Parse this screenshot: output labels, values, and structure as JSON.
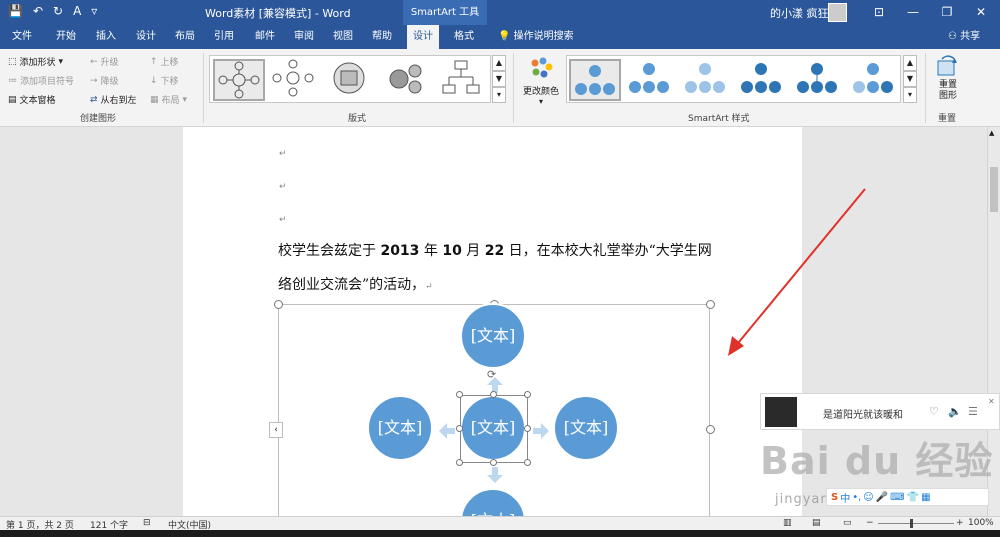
{
  "titlebar": {
    "title": "Word素材 [兼容模式] - Word",
    "context_tab": "SmartArt 工具",
    "user": "的小漾 疯狂",
    "colors": {
      "bar": "#2b579a"
    }
  },
  "tabs": [
    "文件",
    "开始",
    "插入",
    "设计",
    "布局",
    "引用",
    "邮件",
    "审阅",
    "视图",
    "帮助",
    "设计",
    "格式"
  ],
  "tell_me": "操作说明搜索",
  "share": "共享",
  "ribbon": {
    "create": {
      "add_shape": "添加形状",
      "add_bullet": "添加项目符号",
      "text_pane": "文本窗格",
      "promote": "升级",
      "demote": "降级",
      "rtl": "从右到左",
      "move_up": "上移",
      "move_down": "下移",
      "layout": "布局",
      "label": "创建图形"
    },
    "layouts_label": "版式",
    "change_colors": "更改颜色",
    "styles_label": "SmartArt 样式",
    "reset": {
      "btn": "重置图形",
      "label": "重置"
    }
  },
  "doc": {
    "line1": "校学生会兹定于 ",
    "year": "2013",
    "y": " 年 ",
    "month": "10",
    "m": " 月 ",
    "day": "22",
    "rest1": " 日，在本校大礼堂举办“大学生网",
    "line2": "络创业交流会”的活动，",
    "node_text": "[文本]",
    "para_mark": "↵"
  },
  "music": {
    "song": "是道阳光就该暖和"
  },
  "watermark": {
    "logo": "Bai du 经验",
    "url": "jingyan.baidu.com"
  },
  "statusbar": {
    "page": "第 1 页，共 2 页",
    "words": "121 个字",
    "lang": "中文(中国)",
    "zoom": "100%"
  }
}
